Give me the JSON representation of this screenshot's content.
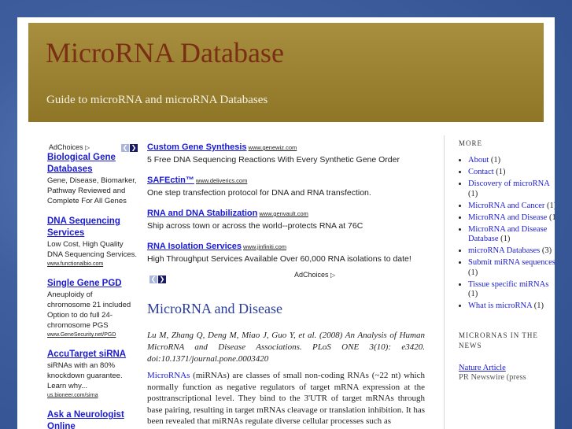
{
  "header": {
    "title": "MicroRNA Database",
    "tagline": "Guide to microRNA and microRNA Databases"
  },
  "adchoices_label": "AdChoices",
  "icons": {
    "adchoices": "play-triangle-icon",
    "prev": "chevron-left-icon",
    "next": "chevron-right-icon"
  },
  "colors": {
    "header_bg": "#9b8232",
    "title": "#7a2e14",
    "link": "#1b1bd0",
    "post_title": "#2b3d9c"
  },
  "left_ads": [
    {
      "title": "Biological Gene Databases",
      "body": "Gene, Disease, Biomarker, Pathway Reviewed and Complete For All Genes",
      "url": ""
    },
    {
      "title": "DNA Sequencing Services",
      "body": "Low Cost, High Quality DNA Sequencing Services.",
      "url": "www.functionalbio.com"
    },
    {
      "title": "Single Gene PGD",
      "body": "Aneuploidy of chromosome 21 included Option to do full 24-chromosome PGS",
      "url": "www.GeneSecurity.net/PGD"
    },
    {
      "title": "AccuTarget siRNA",
      "body": "siRNAs with an 80% knockdown guarantee. Learn why...",
      "url": "us.bioneer.com/sirna"
    },
    {
      "title": "Ask a Neurologist Online",
      "body": "",
      "url": ""
    }
  ],
  "top_ads": [
    {
      "title": "Custom Gene Synthesis",
      "url": "www.genewiz.com",
      "desc": "5 Free DNA Sequencing Reactions With Every Synthetic Gene Order"
    },
    {
      "title": "SAFEctin™",
      "url": "www.deliverics.com",
      "desc": "One step transfection protocol for DNA and RNA transfection."
    },
    {
      "title": "RNA and DNA Stabilization",
      "url": "www.genvault.com",
      "desc": "Ship across town or across the world--protects RNA at 76C"
    },
    {
      "title": "RNA Isolation Services",
      "url": "www.jinfiniti.com",
      "desc": "High Throughput Services Available Over 60,000 RNA isolations to date!"
    }
  ],
  "post": {
    "title": "MicroRNA and Disease",
    "citation": "Lu M, Zhang Q, Deng M, Miao J, Guo Y, et al. (2008) An Analysis of Human MicroRNA and Disease Associations. PLoS ONE 3(10): e3420. doi:10.1371/journal.pone.0003420",
    "body_link": "MicroRNAs",
    "body_text": " (miRNAs) are classes of small non-coding RNAs (~22 nt) which normally function as negative regulators of target mRNA expression at the posttranscriptional level. They bind to the 3'UTR of target mRNAs through base pairing, resulting in target mRNAs cleavage or translation inhibition. It has been revealed that miRNAs regulate diverse cellular processes such as"
  },
  "sidebar": {
    "more_heading": "MORE",
    "more_items": [
      {
        "label": "About",
        "count": " (1)"
      },
      {
        "label": "Contact",
        "count": " (1)"
      },
      {
        "label": "Discovery of microRNA",
        "count": " (1)"
      },
      {
        "label": "MicroRNA and Cancer",
        "count": " (1)"
      },
      {
        "label": "MicroRNA and Disease",
        "count": " (1)"
      },
      {
        "label": "MicroRNA and Disease Database",
        "count": " (1)"
      },
      {
        "label": "microRNA Databases",
        "count": " (3)"
      },
      {
        "label": "Submit miRNA sequences",
        "count": " (1)"
      },
      {
        "label": "Tissue specific miRNAs",
        "count": " (1)"
      },
      {
        "label": "What is microRNA",
        "count": " (1)"
      }
    ],
    "news_heading": "MICRORNAS IN THE NEWS",
    "news_link": "Nature Article",
    "news_source": "PR Newswire (press"
  }
}
